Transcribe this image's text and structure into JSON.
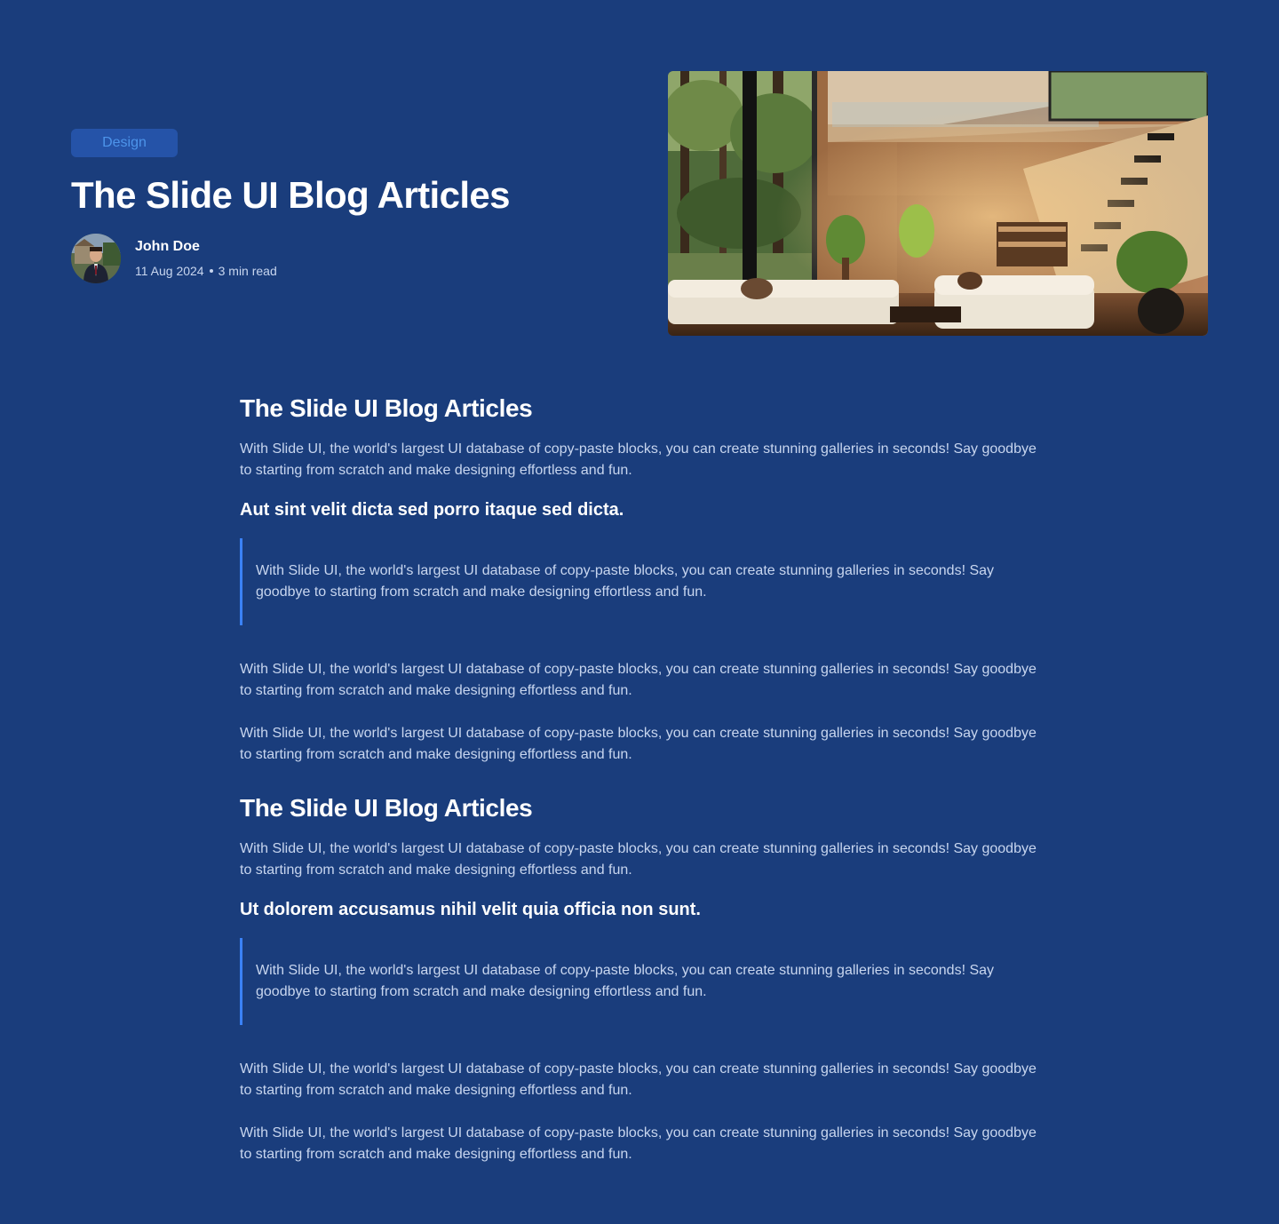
{
  "hero": {
    "tag": "Design",
    "title": "The Slide UI Blog Articles",
    "author": {
      "name": "John Doe",
      "date": "11 Aug 2024",
      "read_time": "3 min read"
    }
  },
  "sections": [
    {
      "title": "The Slide UI Blog Articles",
      "intro": "With Slide UI, the world's largest UI database of copy-paste blocks, you can create stunning galleries in seconds! Say goodbye to starting from scratch and make designing effortless and fun.",
      "subheading": "Aut sint velit dicta sed porro itaque sed dicta.",
      "quote": "With Slide UI, the world's largest UI database of copy-paste blocks, you can create stunning galleries in seconds! Say goodbye to starting from scratch and make designing effortless and fun.",
      "paragraphs": [
        "With Slide UI, the world's largest UI database of copy-paste blocks, you can create stunning galleries in seconds! Say goodbye to starting from scratch and make designing effortless and fun.",
        "With Slide UI, the world's largest UI database of copy-paste blocks, you can create stunning galleries in seconds! Say goodbye to starting from scratch and make designing effortless and fun."
      ]
    },
    {
      "title": "The Slide UI Blog Articles",
      "intro": "With Slide UI, the world's largest UI database of copy-paste blocks, you can create stunning galleries in seconds! Say goodbye to starting from scratch and make designing effortless and fun.",
      "subheading": "Ut dolorem accusamus nihil velit quia officia non sunt.",
      "quote": "With Slide UI, the world's largest UI database of copy-paste blocks, you can create stunning galleries in seconds! Say goodbye to starting from scratch and make designing effortless and fun.",
      "paragraphs": [
        "With Slide UI, the world's largest UI database of copy-paste blocks, you can create stunning galleries in seconds! Say goodbye to starting from scratch and make designing effortless and fun.",
        "With Slide UI, the world's largest UI database of copy-paste blocks, you can create stunning galleries in seconds! Say goodbye to starting from scratch and make designing effortless and fun."
      ]
    }
  ],
  "colors": {
    "background": "#1a3d7c",
    "tag_bg": "#2553a8",
    "tag_text": "#4d94ea",
    "quote_border": "#3b82f6",
    "body_text": "#c8d6ef"
  }
}
